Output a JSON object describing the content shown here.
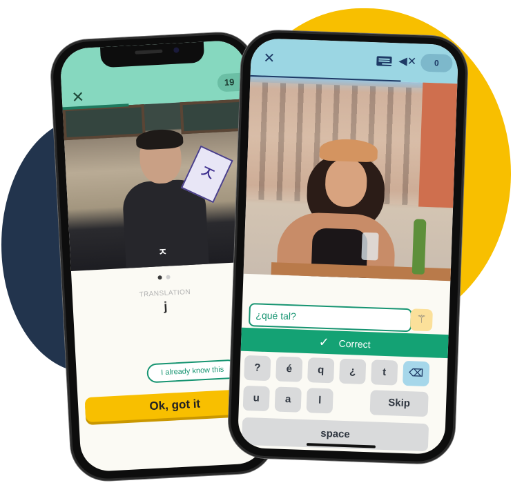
{
  "background": {
    "blob_left_color": "#22344d",
    "blob_right_color": "#f8bf00"
  },
  "phone_left": {
    "header_color": "#86d8bf",
    "close_icon": "close-icon",
    "counter": "19",
    "photo_caption": "ㅈ",
    "flashcard_letter": "ㅈ",
    "carousel": {
      "count": 2,
      "active_index": 0
    },
    "translation_label": "TRANSLATION",
    "translation_value": "j",
    "know_button": "I already know this",
    "ok_button": "Ok, got it"
  },
  "phone_right": {
    "header_color": "#9bd6e3",
    "close_icon": "close-icon",
    "keyboard_icon": "keyboard-icon",
    "mute_icon": "speaker-muted-icon",
    "score": "0",
    "answer_value": "¿qué tal?",
    "hint_icon": "magic-wand-icon",
    "feedback": {
      "icon": "check-icon",
      "label": "Correct",
      "color": "#14a274"
    },
    "keyboard": {
      "row1": [
        "?",
        "é",
        "q",
        "¿",
        "t"
      ],
      "row2": [
        "u",
        "a",
        "l"
      ],
      "skip": "Skip",
      "space": "space",
      "delete_icon": "backspace-icon"
    }
  }
}
